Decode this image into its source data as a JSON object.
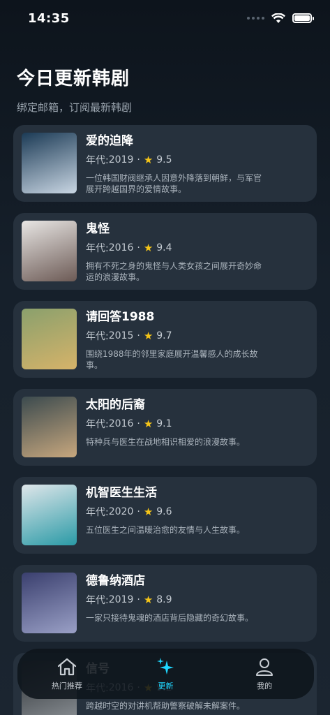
{
  "status": {
    "time": "14:35"
  },
  "header": {
    "title": "今日更新韩剧",
    "subtitle": "绑定邮箱，订阅最新韩剧"
  },
  "year_prefix": "年代: ",
  "dramas": [
    {
      "title": "爱的迫降",
      "year": "2019",
      "rating": "9.5",
      "desc": "一位韩国财阀继承人因意外降落到朝鲜，与军官展开跨越国界的爱情故事。",
      "colors": [
        "#1b3a55",
        "#c9d6e3"
      ]
    },
    {
      "title": "鬼怪",
      "year": "2016",
      "rating": "9.4",
      "desc": "拥有不死之身的鬼怪与人类女孩之间展开奇妙命运的浪漫故事。",
      "colors": [
        "#e8e6e4",
        "#6c5a55"
      ]
    },
    {
      "title": "请回答1988",
      "year": "2015",
      "rating": "9.7",
      "desc": "围绕1988年的邻里家庭展开温馨感人的成长故事。",
      "colors": [
        "#8aa06c",
        "#d6b36a"
      ]
    },
    {
      "title": "太阳的后裔",
      "year": "2016",
      "rating": "9.1",
      "desc": "特种兵与医生在战地相识相爱的浪漫故事。",
      "colors": [
        "#3b4a4e",
        "#c7a77e"
      ]
    },
    {
      "title": "机智医生生活",
      "year": "2020",
      "rating": "9.6",
      "desc": "五位医生之间温暖治愈的友情与人生故事。",
      "colors": [
        "#dfe6ea",
        "#2a9aa6"
      ]
    },
    {
      "title": "德鲁纳酒店",
      "year": "2019",
      "rating": "8.9",
      "desc": "一家只接待鬼魂的酒店背后隐藏的奇幻故事。",
      "colors": [
        "#3a3f6e",
        "#9aa0c6"
      ]
    },
    {
      "title": "信号",
      "year": "2016",
      "rating": "9.2",
      "desc": "跨越时空的对讲机帮助警察破解未解案件。",
      "colors": [
        "#2a2f33",
        "#8a8f94"
      ]
    }
  ],
  "tabs": [
    {
      "label": "热门推荐",
      "icon": "home-icon"
    },
    {
      "label": "更新",
      "icon": "sparkle-icon"
    },
    {
      "label": "我的",
      "icon": "person-icon"
    }
  ],
  "colors": {
    "accent": "#1ed6ff",
    "star": "#f5c518",
    "card": "#26313d"
  }
}
